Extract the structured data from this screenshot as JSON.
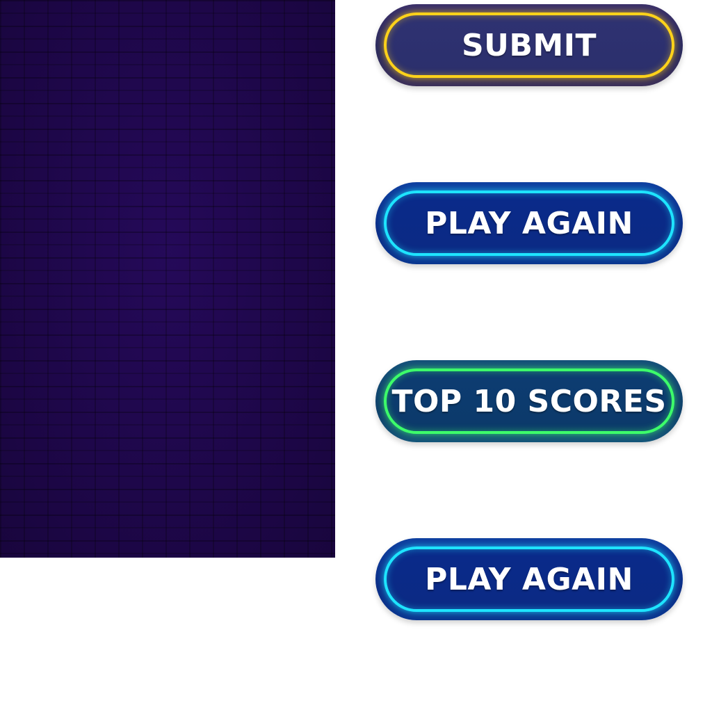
{
  "buttons": {
    "submit": {
      "label": "SUBMIT",
      "glow_color": "#ffd21a"
    },
    "play_again_1": {
      "label": "PLAY AGAIN",
      "glow_color": "#1ee4ff"
    },
    "top_scores": {
      "label": "TOP 10 SCORES",
      "glow_color": "#3dff6a"
    },
    "play_again_2": {
      "label": "PLAY AGAIN",
      "glow_color": "#1ee4ff"
    }
  },
  "colors": {
    "wall": "#1d0648",
    "page_background": "#ffffff"
  }
}
